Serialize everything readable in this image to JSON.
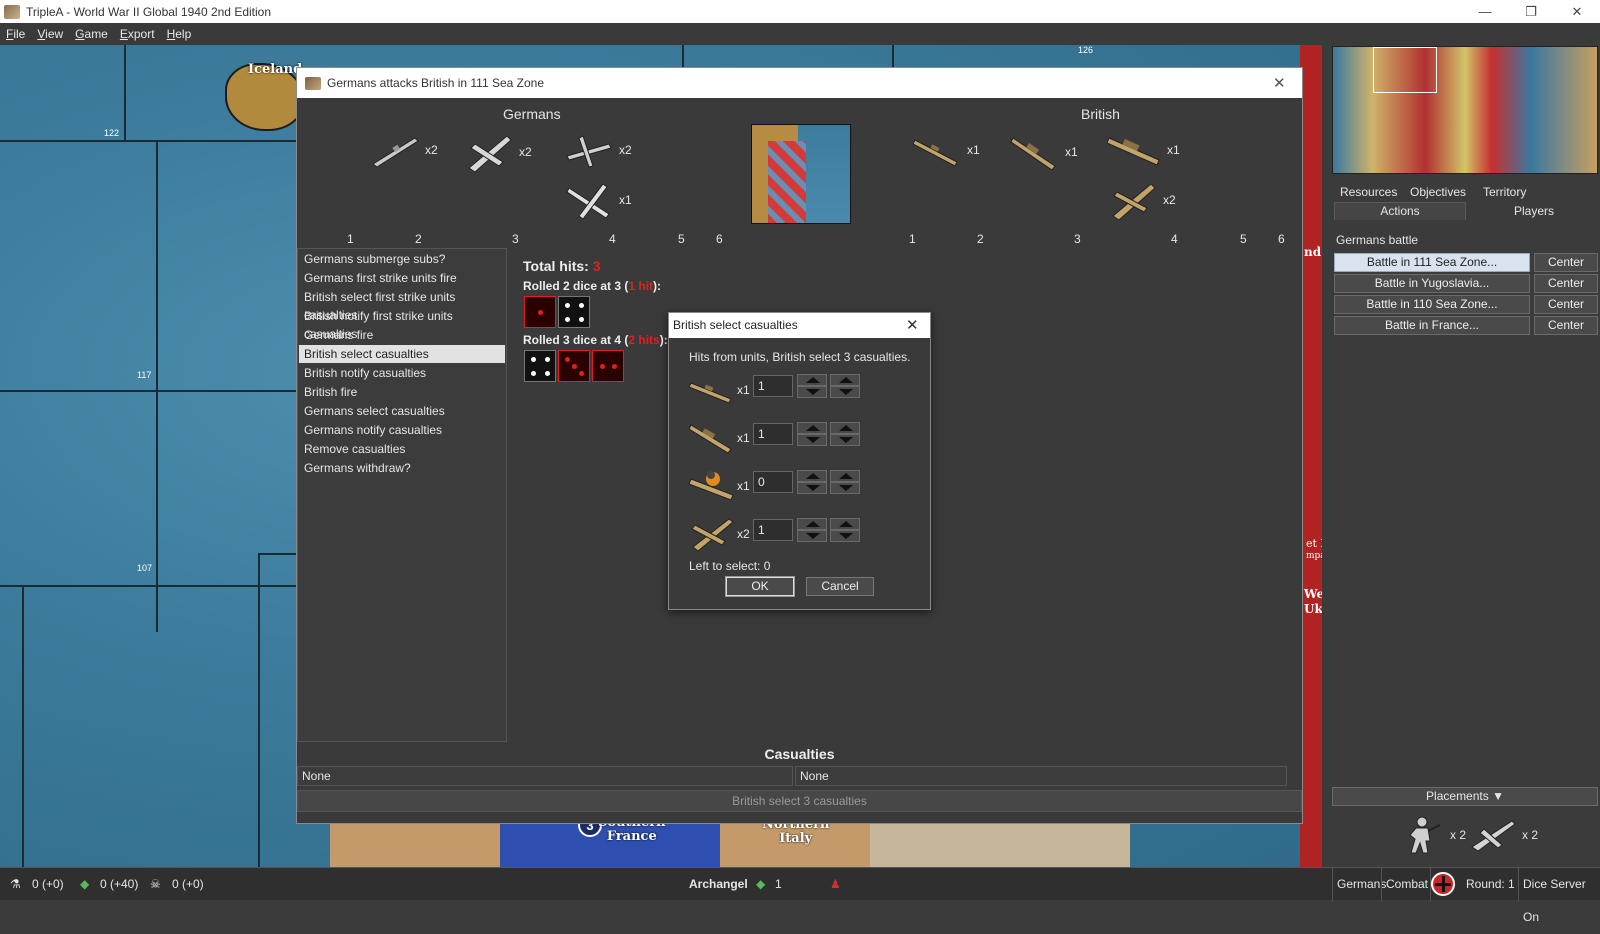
{
  "window": {
    "title": "TripleA - World War II Global 1940 2nd Edition",
    "minimize": "—",
    "restore": "❐",
    "close": "✕"
  },
  "menu": [
    "File",
    "View",
    "Game",
    "Export",
    "Help"
  ],
  "map": {
    "labels": {
      "iceland": "Iceland",
      "southern_france": "Southern\nFrance",
      "northern_italy": "Northern\nItaly",
      "circle_value": "3",
      "zone_122": "122",
      "zone_117": "117",
      "zone_107": "107",
      "zone_126": "126",
      "right_fragments": [
        "nd",
        "et P",
        "mpa",
        "Wes",
        "Ukr"
      ]
    }
  },
  "battle": {
    "title": "Germans attacks British in 111 Sea Zone",
    "close": "✕",
    "attacker": {
      "name": "Germans",
      "units": [
        {
          "icon": "submarine-icon",
          "count": "x2"
        },
        {
          "icon": "fighter-icon",
          "count": "x2"
        },
        {
          "icon": "tactical-bomber-icon",
          "count": "x2"
        },
        {
          "icon": "bomber-icon",
          "count": "x1"
        }
      ]
    },
    "defender": {
      "name": "British",
      "units": [
        {
          "icon": "destroyer-icon",
          "count": "x1"
        },
        {
          "icon": "cruiser-icon",
          "count": "x1"
        },
        {
          "icon": "battleship-icon",
          "count": "x1"
        },
        {
          "icon": "fighter-icon",
          "count": "x2"
        }
      ]
    },
    "die_columns": [
      "1",
      "2",
      "3",
      "4",
      "5",
      "6"
    ],
    "steps": [
      "Germans submerge subs?",
      "Germans first strike units fire",
      "British select first strike units casualties",
      "British notify first strike units casualties",
      "Germans fire",
      "British select casualties",
      "British notify casualties",
      "British fire",
      "Germans select casualties",
      "Germans notify casualties",
      "Remove casualties",
      "Germans withdraw?"
    ],
    "selected_step_index": 5,
    "total_hits_label": "Total hits:",
    "total_hits": "3",
    "rolls": [
      {
        "prefix": "Rolled 2 dice at 3 (",
        "hits": "1 hit",
        "suffix": "):",
        "dice": [
          {
            "value": 1,
            "hit": true
          },
          {
            "value": 4,
            "hit": false
          }
        ]
      },
      {
        "prefix": "Rolled 3 dice at 4 (",
        "hits": "2 hits",
        "suffix": "):",
        "dice": [
          {
            "value": 4,
            "hit": false
          },
          {
            "value": 3,
            "hit": true
          },
          {
            "value": 2,
            "hit": true
          }
        ]
      }
    ],
    "casualties_title": "Casualties",
    "casualties_left": "None",
    "casualties_right": "None",
    "status": "British select 3 casualties"
  },
  "casualty_dialog": {
    "title": "British select casualties",
    "close": "✕",
    "message": "Hits from units,  British select 3 casualties.",
    "rows": [
      {
        "icon": "destroyer-icon",
        "count": "x1",
        "value": "1"
      },
      {
        "icon": "cruiser-icon",
        "count": "x1",
        "value": "1"
      },
      {
        "icon": "damaged-battleship-icon",
        "count": "x1",
        "value": "0"
      },
      {
        "icon": "fighter-icon",
        "count": "x2",
        "value": "1"
      }
    ],
    "left_to_select": "Left to select: 0",
    "ok": "OK",
    "cancel": "Cancel"
  },
  "right_panel": {
    "tabs_row1": [
      "Resources",
      "Objectives",
      "Territory"
    ],
    "tabs_row2": [
      "Actions",
      "Players"
    ],
    "section_title": "Germans battle",
    "battles": [
      {
        "label": "Battle in 111 Sea Zone...",
        "center": "Center",
        "selected": true
      },
      {
        "label": "Battle in Yugoslavia...",
        "center": "Center",
        "selected": false
      },
      {
        "label": "Battle in 110 Sea Zone...",
        "center": "Center",
        "selected": false
      },
      {
        "label": "Battle in France...",
        "center": "Center",
        "selected": false
      }
    ],
    "placements": "Placements ▼",
    "placement_units": [
      {
        "icon": "infantry-icon",
        "count": "x 2"
      },
      {
        "icon": "fighter-icon",
        "count": "x 2"
      }
    ]
  },
  "statusbar": {
    "tech": "0 (+0)",
    "pus": "0 (+40)",
    "kills": "0 (+0)",
    "territory": "Archangel",
    "territory_value": "1",
    "player": "Germans",
    "phase": "Combat",
    "round": "Round: 1",
    "dice": "Dice Server On"
  },
  "colors": {
    "sea": "#3d7c9c",
    "dialog_bg": "#3a3a3a",
    "hit_red": "#e02020",
    "soviet_red": "#b12222"
  }
}
